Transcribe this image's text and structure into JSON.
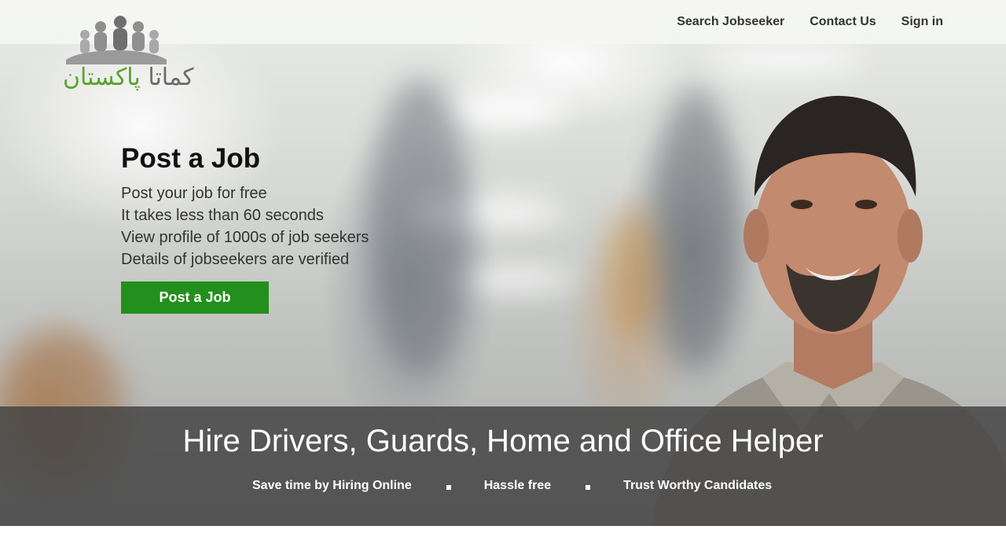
{
  "brand": {
    "logo_text_part1": "کماتا",
    "logo_text_part2": "پاکستان",
    "colors": {
      "green": "#5aa32a",
      "gray": "#6a6a6a"
    }
  },
  "nav": {
    "items": [
      {
        "label": "Search Jobseeker"
      },
      {
        "label": "Contact Us"
      },
      {
        "label": "Sign in"
      }
    ]
  },
  "hero": {
    "title": "Post a Job",
    "points": [
      "Post your job for free",
      "It takes less than 60 seconds",
      "View profile of 1000s of job seekers",
      "Details of jobseekers are verified"
    ],
    "cta_label": "Post a Job",
    "cta_color": "#238f1c"
  },
  "banner": {
    "headline": "Hire Drivers, Guards, Home and Office Helper",
    "features": [
      "Save time by Hiring Online",
      "Hassle free",
      "Trust Worthy Candidates"
    ]
  }
}
